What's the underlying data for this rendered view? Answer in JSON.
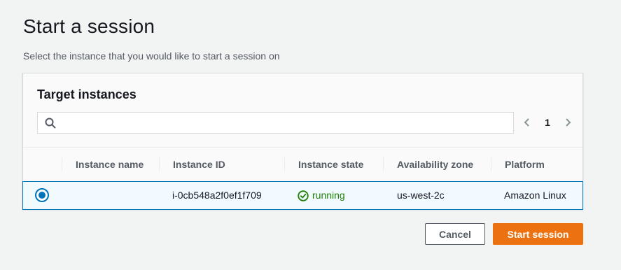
{
  "page": {
    "title": "Start a session",
    "description": "Select the instance that you would like to start a session on"
  },
  "panel": {
    "title": "Target instances",
    "search": {
      "value": "",
      "placeholder": ""
    },
    "pagination": {
      "current_page": "1"
    }
  },
  "table": {
    "columns": [
      "Instance name",
      "Instance ID",
      "Instance state",
      "Availability zone",
      "Platform"
    ],
    "rows": [
      {
        "selected": true,
        "instance_name": "",
        "instance_id": "i-0cb548a2f0ef1f709",
        "instance_state": "running",
        "availability_zone": "us-west-2c",
        "platform": "Amazon Linux"
      }
    ]
  },
  "actions": {
    "cancel_label": "Cancel",
    "start_label": "Start session"
  },
  "colors": {
    "accent": "#0073bb",
    "primary_button": "#ec7211",
    "running": "#1d8102"
  },
  "icons": {
    "search": "search-icon",
    "prev": "chevron-left-icon",
    "next": "chevron-right-icon",
    "status": "check-circle-icon"
  }
}
